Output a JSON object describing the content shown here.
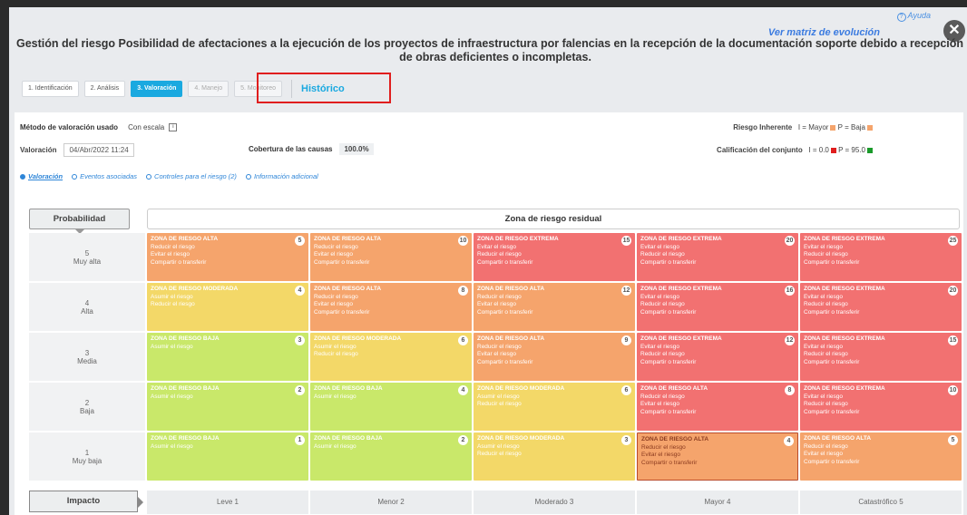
{
  "header": {
    "help_label": "Ayuda",
    "close_label": "✕",
    "matrix_link": "Ver matriz de evolución",
    "title_line1": "Gestión del riesgo Posibilidad de afectaciones a la ejecución de los proyectos de infraestructura por falencias en la recepción de la documentación soporte debido a recepción de estructuración tecnica",
    "title_line2": "de obras deficientes o incompletas."
  },
  "tabs": [
    {
      "label": "1. Identificación",
      "state": "normal"
    },
    {
      "label": "2. Análisis",
      "state": "normal"
    },
    {
      "label": "3. Valoración",
      "state": "active"
    },
    {
      "label": "4. Manejo",
      "state": "disabled"
    },
    {
      "label": "5. Monitoreo",
      "state": "disabled"
    }
  ],
  "historico_label": "Histórico",
  "summary": {
    "metodo_label": "Método de valoración usado",
    "metodo_value": "Con escala",
    "valoracion_label": "Valoración",
    "valoracion_date": "04/Abr/2022 11:24",
    "cobertura_label": "Cobertura de las causas",
    "cobertura_value": "100.0%",
    "riesgo_label": "Riesgo Inherente",
    "riesgo_value": "I = Mayor",
    "riesgo_p": "P = Baja",
    "calif_label": "Calificación del conjunto",
    "calif_value": "I = 0.0",
    "calif_p": "P = 95.0"
  },
  "subtabs": [
    "Valoración",
    "Eventos asociadas",
    "Controles para el riesgo (2)",
    "Información adicional"
  ],
  "matrix": {
    "prob_header": "Probabilidad",
    "zona_header": "Zona de riesgo residual",
    "impact_header": "Impacto",
    "rows": [
      {
        "num": "5",
        "label": "Muy alta"
      },
      {
        "num": "4",
        "label": "Alta"
      },
      {
        "num": "3",
        "label": "Media"
      },
      {
        "num": "2",
        "label": "Baja"
      },
      {
        "num": "1",
        "label": "Muy baja"
      }
    ],
    "impacts": [
      "Leve 1",
      "Menor 2",
      "Moderado 3",
      "Mayor 4",
      "Catastrófico 5"
    ],
    "colors": {
      "alta": "#f5a46c",
      "extrema": "#f27171",
      "moderada": "#f3d868",
      "baja": "#c9e86a"
    },
    "cells": [
      [
        {
          "zone": "alta",
          "title": "ZONA DE RIESGO ALTA",
          "n": "5",
          "lines": [
            "Reducir el riesgo",
            "Evitar el riesgo",
            "Compartir o transferir"
          ]
        },
        {
          "zone": "alta",
          "title": "ZONA DE RIESGO ALTA",
          "n": "10",
          "lines": [
            "Reducir el riesgo",
            "Evitar el riesgo",
            "Compartir o transferir"
          ]
        },
        {
          "zone": "extrema",
          "title": "ZONA DE RIESGO EXTREMA",
          "n": "15",
          "lines": [
            "Evitar el riesgo",
            "Reducir el riesgo",
            "Compartir o transferir"
          ]
        },
        {
          "zone": "extrema",
          "title": "ZONA DE RIESGO EXTREMA",
          "n": "20",
          "lines": [
            "Evitar el riesgo",
            "Reducir el riesgo",
            "Compartir o transferir"
          ]
        },
        {
          "zone": "extrema",
          "title": "ZONA DE RIESGO EXTREMA",
          "n": "25",
          "lines": [
            "Evitar el riesgo",
            "Reducir el riesgo",
            "Compartir o transferir"
          ]
        }
      ],
      [
        {
          "zone": "moderada",
          "title": "ZONA DE RIESGO MODERADA",
          "n": "4",
          "lines": [
            "Asumir el riesgo",
            "Reducir el riesgo"
          ]
        },
        {
          "zone": "alta",
          "title": "ZONA DE RIESGO ALTA",
          "n": "8",
          "lines": [
            "Reducir el riesgo",
            "Evitar el riesgo",
            "Compartir o transferir"
          ]
        },
        {
          "zone": "alta",
          "title": "ZONA DE RIESGO ALTA",
          "n": "12",
          "lines": [
            "Reducir el riesgo",
            "Evitar el riesgo",
            "Compartir o transferir"
          ]
        },
        {
          "zone": "extrema",
          "title": "ZONA DE RIESGO EXTREMA",
          "n": "16",
          "lines": [
            "Evitar el riesgo",
            "Reducir el riesgo",
            "Compartir o transferir"
          ]
        },
        {
          "zone": "extrema",
          "title": "ZONA DE RIESGO EXTREMA",
          "n": "20",
          "lines": [
            "Evitar el riesgo",
            "Reducir el riesgo",
            "Compartir o transferir"
          ]
        }
      ],
      [
        {
          "zone": "baja",
          "title": "ZONA DE RIESGO BAJA",
          "n": "3",
          "lines": [
            "Asumir el riesgo"
          ]
        },
        {
          "zone": "moderada",
          "title": "ZONA DE RIESGO MODERADA",
          "n": "6",
          "lines": [
            "Asumir el riesgo",
            "Reducir el riesgo"
          ]
        },
        {
          "zone": "alta",
          "title": "ZONA DE RIESGO ALTA",
          "n": "9",
          "lines": [
            "Reducir el riesgo",
            "Evitar el riesgo",
            "Compartir o transferir"
          ]
        },
        {
          "zone": "extrema",
          "title": "ZONA DE RIESGO EXTREMA",
          "n": "12",
          "lines": [
            "Evitar el riesgo",
            "Reducir el riesgo",
            "Compartir o transferir"
          ]
        },
        {
          "zone": "extrema",
          "title": "ZONA DE RIESGO EXTREMA",
          "n": "15",
          "lines": [
            "Evitar el riesgo",
            "Reducir el riesgo",
            "Compartir o transferir"
          ]
        }
      ],
      [
        {
          "zone": "baja",
          "title": "ZONA DE RIESGO BAJA",
          "n": "2",
          "lines": [
            "Asumir el riesgo"
          ]
        },
        {
          "zone": "baja",
          "title": "ZONA DE RIESGO BAJA",
          "n": "4",
          "lines": [
            "Asumir el riesgo"
          ]
        },
        {
          "zone": "moderada",
          "title": "ZONA DE RIESGO MODERADA",
          "n": "6",
          "lines": [
            "Asumir el riesgo",
            "Reducir el riesgo"
          ]
        },
        {
          "zone": "extrema",
          "title": "ZONA DE RIESGO ALTA",
          "n": "8",
          "lines": [
            "Reducir el riesgo",
            "Evitar el riesgo",
            "Compartir o transferir"
          ]
        },
        {
          "zone": "extrema",
          "title": "ZONA DE RIESGO EXTREMA",
          "n": "10",
          "lines": [
            "Evitar el riesgo",
            "Reducir el riesgo",
            "Compartir o transferir"
          ]
        }
      ],
      [
        {
          "zone": "baja",
          "title": "ZONA DE RIESGO BAJA",
          "n": "1",
          "lines": [
            "Asumir el riesgo"
          ]
        },
        {
          "zone": "baja",
          "title": "ZONA DE RIESGO BAJA",
          "n": "2",
          "lines": [
            "Asumir el riesgo"
          ]
        },
        {
          "zone": "moderada",
          "title": "ZONA DE RIESGO MODERADA",
          "n": "3",
          "lines": [
            "Asumir el riesgo",
            "Reducir el riesgo"
          ]
        },
        {
          "zone": "alta",
          "title": "ZONA DE RIESGO ALTA",
          "n": "4",
          "lines": [
            "Reducir el riesgo",
            "Evitar el riesgo",
            "Compartir o transferir"
          ],
          "selected": true
        },
        {
          "zone": "alta",
          "title": "ZONA DE RIESGO ALTA",
          "n": "5",
          "lines": [
            "Reducir el riesgo",
            "Evitar el riesgo",
            "Compartir o transferir"
          ]
        }
      ]
    ]
  }
}
